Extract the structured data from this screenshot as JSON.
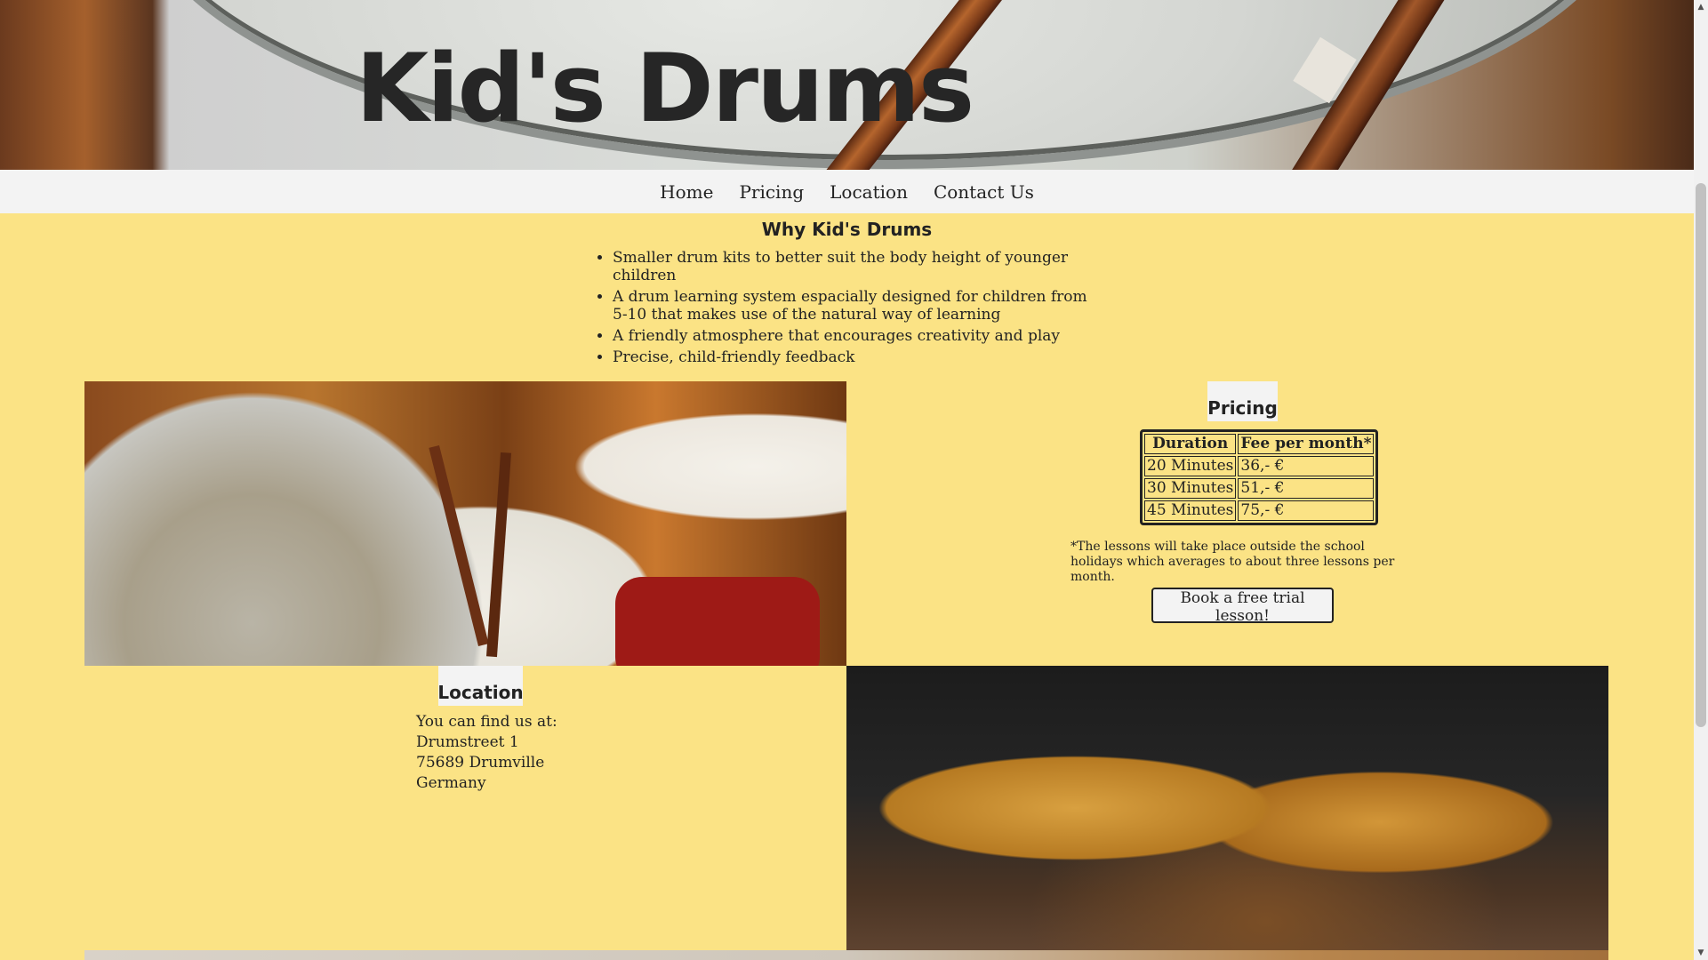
{
  "hero": {
    "title": "Kid's Drums"
  },
  "nav": {
    "items": [
      {
        "label": "Home"
      },
      {
        "label": "Pricing"
      },
      {
        "label": "Location"
      },
      {
        "label": "Contact Us"
      }
    ]
  },
  "why": {
    "title": "Why Kid's Drums",
    "items": [
      "Smaller drum kits to better suit the body height of younger children",
      "A drum learning system espacially designed for children from 5-10 that makes use of the natural way of learning",
      "A friendly atmosphere that encourages creativity and play",
      "Precise, child-friendly feedback"
    ]
  },
  "pricing": {
    "title": "Pricing",
    "headers": [
      "Duration",
      "Fee per month*"
    ],
    "rows": [
      [
        "20 Minutes",
        "36,- €"
      ],
      [
        "30 Minutes",
        "51,- €"
      ],
      [
        "45 Minutes",
        "75,- €"
      ]
    ],
    "footnote": "*The lessons will take place outside the school holidays which averages to about three lessons per month.",
    "button_label": "Book a free trial lesson!"
  },
  "location": {
    "title": "Location",
    "lines": [
      "You can find us at:",
      "Drumstreet 1",
      "75689 Drumville",
      "Germany"
    ]
  },
  "icons": {
    "scroll_up": "scroll-up-arrow-icon",
    "scroll_down": "scroll-down-arrow-icon"
  },
  "colors": {
    "page_background": "#fbe385",
    "nav_background": "#f3f3f3",
    "text": "#222222"
  }
}
